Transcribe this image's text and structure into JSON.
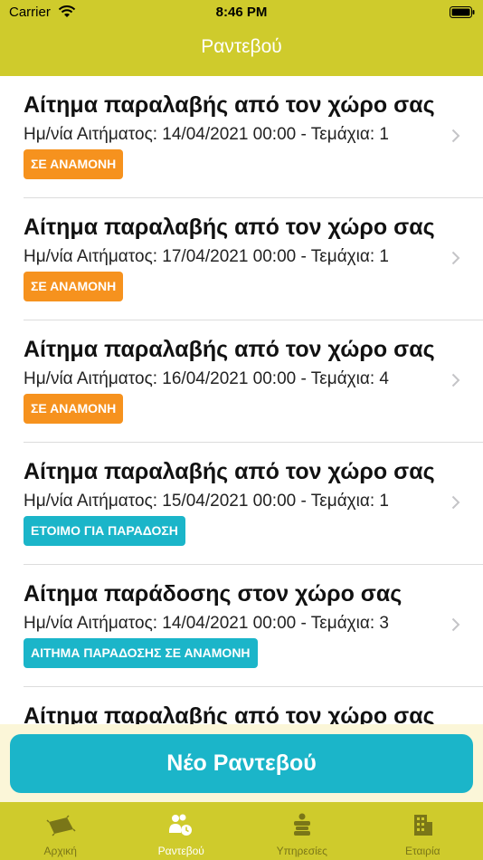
{
  "status_bar": {
    "carrier": "Carrier",
    "time": "8:46 PM"
  },
  "header": {
    "title": "Ραντεβού"
  },
  "appointments": [
    {
      "title": "Αίτημα παραλαβής από τον χώρο σας",
      "subtitle": "Ημ/νία Αιτήματος: 14/04/2021 00:00 - Τεμάχια: 1",
      "status": "ΣΕ ΑΝΑΜΟΝΗ",
      "status_color": "#f6921e"
    },
    {
      "title": "Αίτημα παραλαβής από τον χώρο σας",
      "subtitle": "Ημ/νία Αιτήματος: 17/04/2021 00:00 - Τεμάχια: 1",
      "status": "ΣΕ ΑΝΑΜΟΝΗ",
      "status_color": "#f6921e"
    },
    {
      "title": "Αίτημα παραλαβής από τον χώρο σας",
      "subtitle": "Ημ/νία Αιτήματος: 16/04/2021 00:00 - Τεμάχια: 4",
      "status": "ΣΕ ΑΝΑΜΟΝΗ",
      "status_color": "#f6921e"
    },
    {
      "title": "Αίτημα παραλαβής από τον χώρο σας",
      "subtitle": "Ημ/νία Αιτήματος: 15/04/2021 00:00 - Τεμάχια: 1",
      "status": "ΕΤΟΙΜΟ ΓΙΑ ΠΑΡΑΔΟΣΗ",
      "status_color": "#1bb5c9"
    },
    {
      "title": "Αίτημα παράδοσης στον χώρο σας",
      "subtitle": "Ημ/νία Αιτήματος: 14/04/2021 00:00 - Τεμάχια: 3",
      "status": "ΑΙΤΗΜΑ ΠΑΡΑΔΟΣΗΣ ΣΕ ΑΝΑΜΟΝΗ",
      "status_color": "#1bb5c9"
    },
    {
      "title": "Αίτημα παραλαβής από τον χώρο σας"
    }
  ],
  "new_appointment_button": "Νέο Ραντεβού",
  "tabs": [
    {
      "label": "Αρχική",
      "icon": "carpet-icon"
    },
    {
      "label": "Ραντεβού",
      "icon": "appointments-icon",
      "active": true
    },
    {
      "label": "Υπηρεσίες",
      "icon": "services-icon"
    },
    {
      "label": "Εταιρία",
      "icon": "company-icon"
    }
  ],
  "colors": {
    "brand": "#cfcb2c",
    "accent": "#1bb5c9",
    "pending": "#f6921e"
  }
}
